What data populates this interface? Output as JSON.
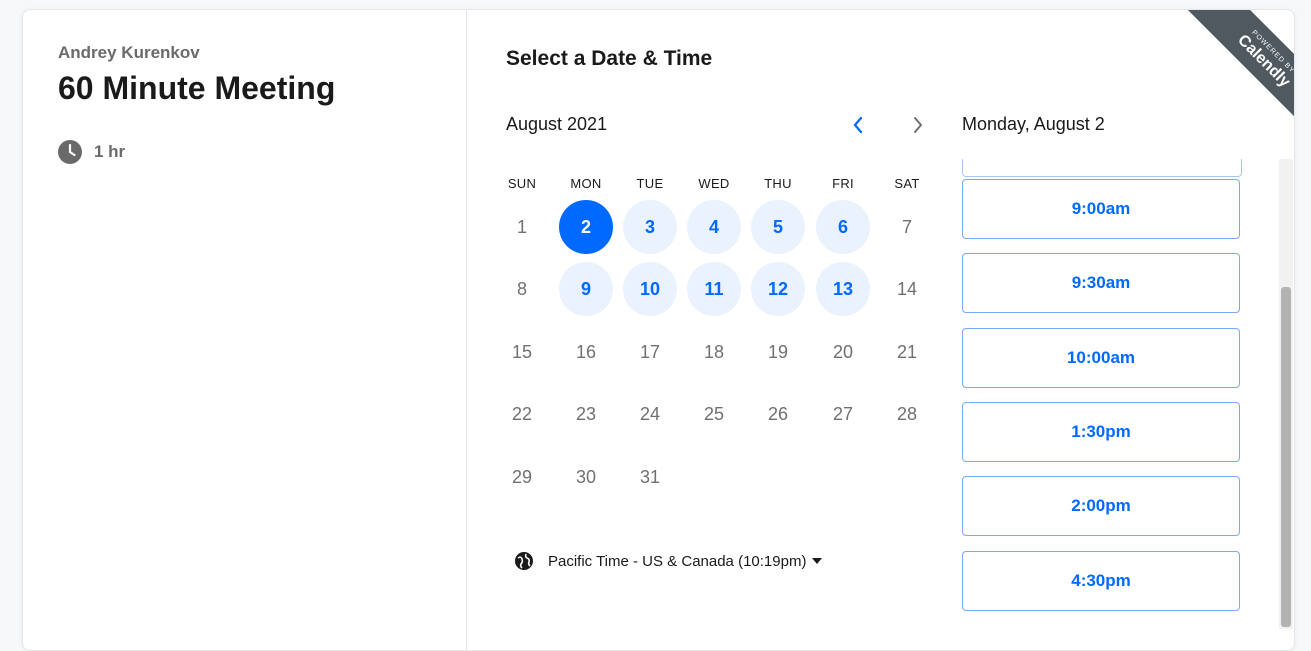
{
  "event": {
    "host": "Andrey Kurenkov",
    "title": "60 Minute Meeting",
    "duration": "1 hr"
  },
  "picker": {
    "title": "Select a Date & Time",
    "month": "August 2021",
    "weekdays": [
      "SUN",
      "MON",
      "TUE",
      "WED",
      "THU",
      "FRI",
      "SAT"
    ],
    "weeks": [
      [
        "1",
        "2",
        "3",
        "4",
        "5",
        "6",
        "7"
      ],
      [
        "8",
        "9",
        "10",
        "11",
        "12",
        "13",
        "14"
      ],
      [
        "15",
        "16",
        "17",
        "18",
        "19",
        "20",
        "21"
      ],
      [
        "22",
        "23",
        "24",
        "25",
        "26",
        "27",
        "28"
      ],
      [
        "29",
        "30",
        "31",
        "",
        "",
        "",
        ""
      ]
    ],
    "available_days": [
      "2",
      "3",
      "4",
      "5",
      "6",
      "9",
      "10",
      "11",
      "12",
      "13"
    ],
    "selected_day": "2",
    "timezone": "Pacific Time - US & Canada (10:19pm)"
  },
  "times": {
    "date_label": "Monday, August 2",
    "slots": [
      "9:00am",
      "9:30am",
      "10:00am",
      "1:30pm",
      "2:00pm",
      "4:30pm"
    ]
  },
  "badge": {
    "powered_by": "POWERED BY",
    "brand": "Calendly"
  },
  "colors": {
    "accent": "#0069ff",
    "available_bg": "#eaf2fe",
    "text": "#1a1a1a",
    "muted": "#707070"
  }
}
